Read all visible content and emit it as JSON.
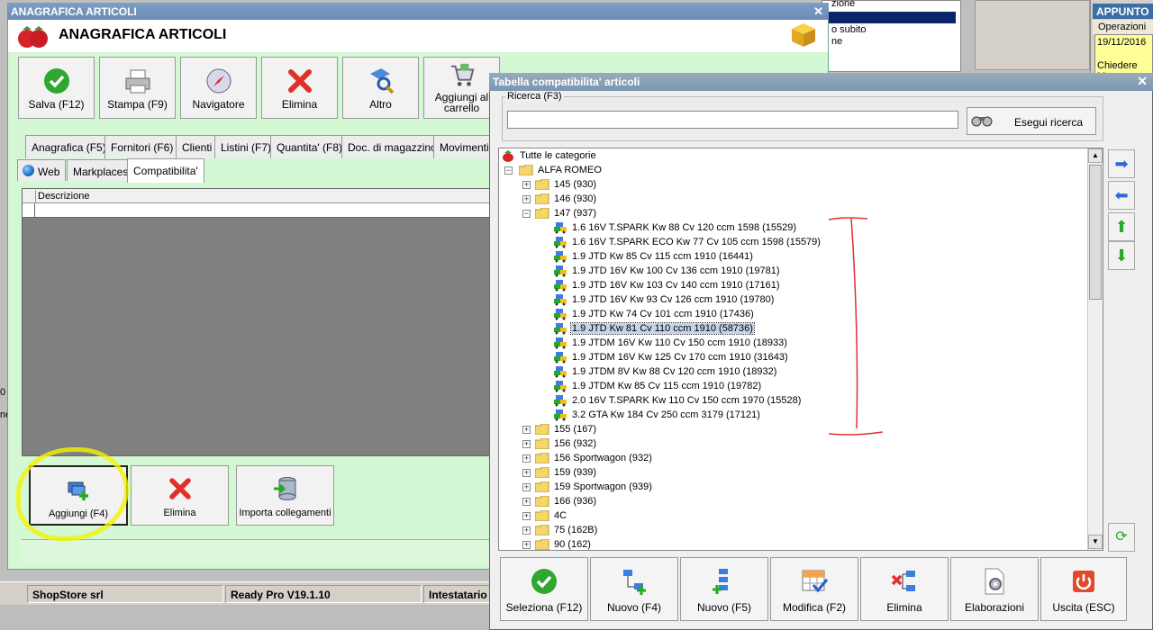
{
  "background": {
    "list_items": [
      "zione",
      "o subito",
      "ne"
    ],
    "appunto": {
      "title": "APPUNTO",
      "ops_label": "Operazioni",
      "date": "19/11/2016",
      "note": "Chiedere Ma"
    },
    "side_fragments": [
      "0",
      "ne"
    ]
  },
  "main_window": {
    "title": "ANAGRAFICA ARTICOLI",
    "header_title": "ANAGRAFICA ARTICOLI",
    "toolbar": [
      {
        "label": "Salva (F12)",
        "icon": "check-icon"
      },
      {
        "label": "Stampa (F9)",
        "icon": "printer-icon"
      },
      {
        "label": "Navigatore",
        "icon": "compass-icon"
      },
      {
        "label": "Elimina",
        "icon": "delete-x-icon"
      },
      {
        "label": "Altro",
        "icon": "magnifier-icon"
      },
      {
        "label": "Aggiungi al carrello",
        "icon": "cart-icon"
      }
    ],
    "tabs_row1": [
      "Anagrafica (F5)",
      "Fornitori (F6)",
      "Clienti",
      "Listini (F7)",
      "Quantita' (F8)",
      "Doc. di magazzino",
      "Movimenti"
    ],
    "tabs_row2": [
      "Web",
      "Markplaces",
      "Compatibilita'"
    ],
    "grid_header": "Descrizione",
    "bottom_buttons": [
      {
        "label": "Aggiungi (F4)",
        "icon": "add-link-icon"
      },
      {
        "label": "Elimina",
        "icon": "delete-x-icon"
      },
      {
        "label": "Importa collegamenti",
        "icon": "database-import-icon"
      }
    ]
  },
  "status_bar": {
    "company": "ShopStore srl",
    "version": "Ready Pro V19.1.10",
    "holder": "Intestatario"
  },
  "dialog": {
    "title": "Tabella compatibilita' articoli",
    "search_label": "Ricerca (F3)",
    "search_value": "",
    "search_button": "Esegui ricerca",
    "tree": {
      "root": "Tutte le categorie",
      "brand": "ALFA ROMEO",
      "models_before": [
        "145 (930)",
        "146 (930)"
      ],
      "expanded_model": "147 (937)",
      "versions": [
        "1.6 16V T.SPARK  Kw 88 Cv 120 ccm 1598 (15529)",
        "1.6 16V T.SPARK ECO  Kw 77 Cv 105 ccm 1598 (15579)",
        "1.9 JTD  Kw 85 Cv 115 ccm 1910 (16441)",
        "1.9 JTD  16V Kw 100 Cv 136 ccm 1910 (19781)",
        "1.9 JTD  16V Kw 103 Cv 140 ccm 1910 (17161)",
        "1.9 JTD  16V Kw 93 Cv 126 ccm 1910 (19780)",
        "1.9 JTD Kw 74 Cv 101 ccm 1910 (17436)",
        "1.9 JTD Kw 81 Cv 110 ccm 1910 (58736)",
        "1.9 JTDM  16V Kw 110 Cv 150 ccm 1910 (18933)",
        "1.9 JTDM  16V Kw 125 Cv 170 ccm 1910 (31643)",
        "1.9 JTDM 8V Kw 88 Cv 120 ccm 1910 (18932)",
        "1.9 JTDM Kw 85 Cv 115 ccm 1910 (19782)",
        "2.0 16V T.SPARK  Kw 110 Cv 150 ccm 1970 (15528)",
        "3.2 GTA Kw 184 Cv 250 ccm 3179 (17121)"
      ],
      "selected_index": 7,
      "models_after": [
        "155 (167)",
        "156 (932)",
        "156 Sportwagon (932)",
        "159 (939)",
        "159 Sportwagon (939)",
        "166 (936)",
        "4C",
        "75 (162B)",
        "90 (162)"
      ]
    },
    "buttons": [
      {
        "label": "Seleziona (F12)",
        "icon": "check-icon"
      },
      {
        "label": "Nuovo (F4)",
        "icon": "tree-add-icon"
      },
      {
        "label": "Nuovo (F5)",
        "icon": "tree-add-child-icon"
      },
      {
        "label": "Modifica (F2)",
        "icon": "edit-grid-icon"
      },
      {
        "label": "Elimina",
        "icon": "tree-delete-icon"
      },
      {
        "label": "Elaborazioni",
        "icon": "gear-document-icon"
      },
      {
        "label": "Uscita (ESC)",
        "icon": "power-icon"
      }
    ]
  }
}
